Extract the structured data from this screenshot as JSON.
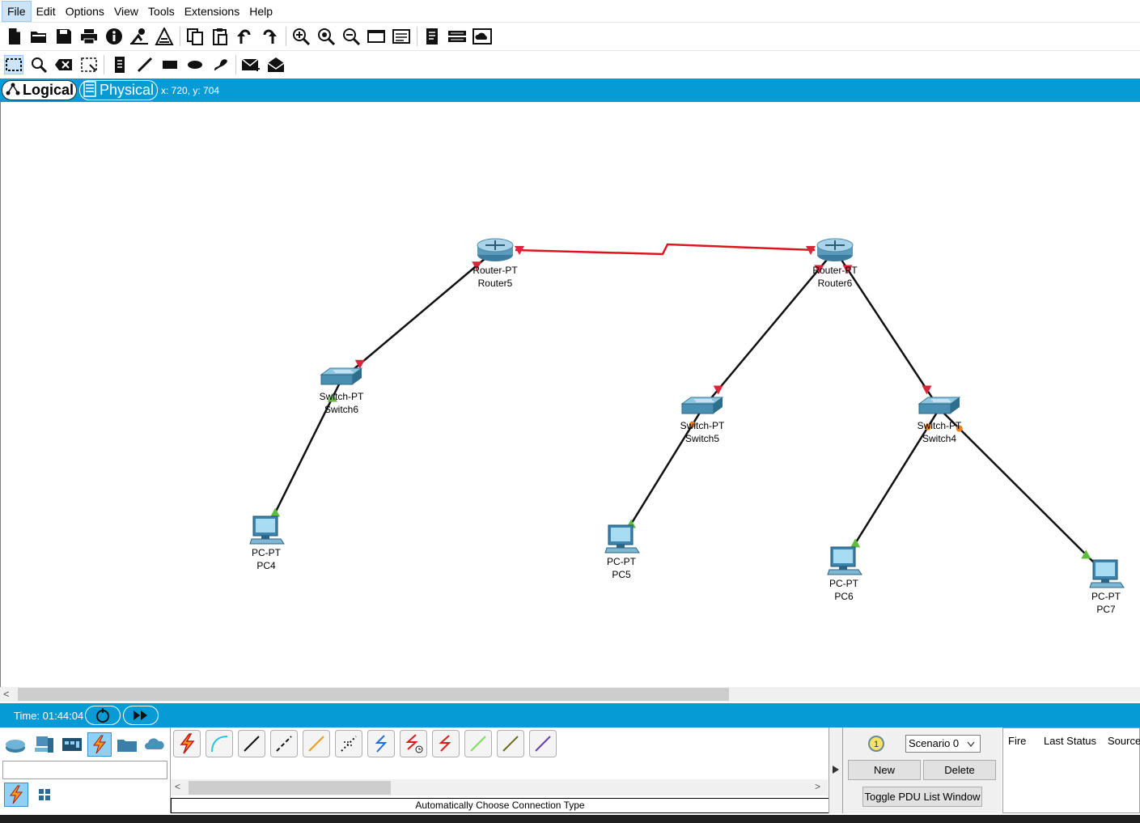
{
  "menu": [
    "File",
    "Edit",
    "Options",
    "View",
    "Tools",
    "Extensions",
    "Help"
  ],
  "view_tabs": {
    "logical": "Logical",
    "physical": "Physical",
    "coordinates": "x: 720, y: 704"
  },
  "devices": [
    {
      "id": "router5",
      "type": "Router-PT",
      "name": "Router5"
    },
    {
      "id": "router6",
      "type": "Router-PT",
      "name": "Router6"
    },
    {
      "id": "switch6",
      "type": "Switch-PT",
      "name": "Switch6"
    },
    {
      "id": "switch5",
      "type": "Switch-PT",
      "name": "Switch5"
    },
    {
      "id": "switch4",
      "type": "Switch-PT",
      "name": "Switch4"
    },
    {
      "id": "pc4",
      "type": "PC-PT",
      "name": "PC4"
    },
    {
      "id": "pc5",
      "type": "PC-PT",
      "name": "PC5"
    },
    {
      "id": "pc6",
      "type": "PC-PT",
      "name": "PC6"
    },
    {
      "id": "pc7",
      "type": "PC-PT",
      "name": "PC7"
    }
  ],
  "links": [
    {
      "from": "router5",
      "to": "router6",
      "kind": "serial",
      "status": "down"
    },
    {
      "from": "router5",
      "to": "switch6",
      "kind": "copper",
      "status": "down"
    },
    {
      "from": "router6",
      "to": "switch5",
      "kind": "copper",
      "status": "down"
    },
    {
      "from": "router6",
      "to": "switch4",
      "kind": "copper",
      "status": "down"
    },
    {
      "from": "switch6",
      "to": "pc4",
      "kind": "copper",
      "status": "up"
    },
    {
      "from": "switch5",
      "to": "pc5",
      "kind": "copper",
      "status": "up"
    },
    {
      "from": "switch4",
      "to": "pc6",
      "kind": "copper",
      "status": "up"
    },
    {
      "from": "switch4",
      "to": "pc7",
      "kind": "copper",
      "status": "up"
    }
  ],
  "colors": {
    "accent": "#069bd5",
    "link_down": "#d9263a",
    "link_up": "#5bbf3a",
    "link_pending": "#f07d1a",
    "serial": "#e0141e"
  },
  "time": {
    "label": "Time: 01:44:04"
  },
  "connections": {
    "status": "Automatically Choose Connection Type",
    "types": [
      "automatic",
      "console",
      "copper-straight",
      "copper-cross",
      "fiber",
      "phone",
      "coaxial",
      "serial-dce",
      "serial-dte",
      "octal",
      "iot-custom",
      "usb"
    ]
  },
  "scenario": {
    "selected": "Scenario 0",
    "new_label": "New",
    "delete_label": "Delete",
    "toggle_label": "Toggle PDU List Window"
  },
  "pdu_table": {
    "columns": [
      "Fire",
      "Last Status",
      "Source"
    ]
  }
}
